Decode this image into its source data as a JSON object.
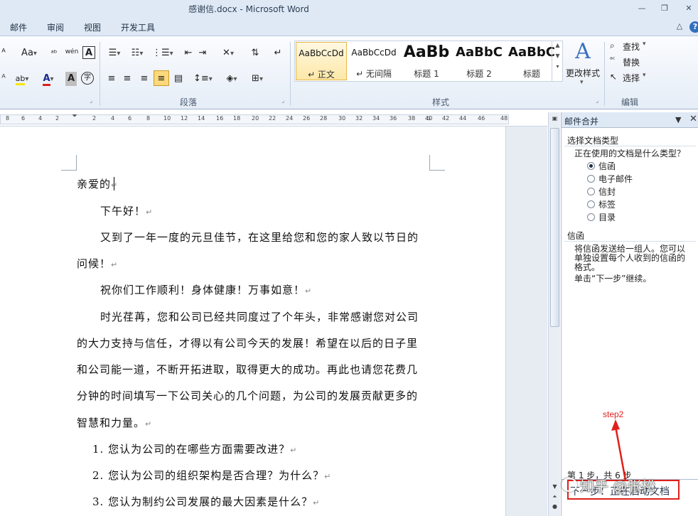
{
  "window": {
    "title": "感谢信.docx - Microsoft Word",
    "minimize": "—",
    "restore": "❐",
    "close": "✕"
  },
  "tabs": [
    "邮件",
    "审阅",
    "视图",
    "开发工具"
  ],
  "tab_controls": {
    "collapse": "△",
    "help": "?"
  },
  "ribbon": {
    "font": {
      "aa_label": "Aa",
      "pinyin_label": "wén",
      "border_char_label": "A",
      "font_color_label": "A",
      "highlight_label": "ab",
      "shading_label": "A",
      "enclose_label": "字"
    },
    "paragraph_label": "段落",
    "styles_label": "样式",
    "editing_label": "编辑",
    "styles": [
      {
        "preview": "AaBbCcDd",
        "name": "↵ 正文",
        "selected": true
      },
      {
        "preview": "AaBbCcDd",
        "name": "↵ 无间隔",
        "selected": false
      },
      {
        "preview": "AaBb",
        "name": "标题 1",
        "selected": false
      },
      {
        "preview": "AaBbC",
        "name": "标题 2",
        "selected": false
      },
      {
        "preview": "AaBbC",
        "name": "标题",
        "selected": false
      }
    ],
    "change_styles_label": "更改样式",
    "find_label": "查找",
    "replace_label": "替换",
    "select_label": "选择"
  },
  "ruler": {
    "numbers": [
      "8",
      "6",
      "4",
      "2",
      "2",
      "4",
      "6",
      "8",
      "10",
      "12",
      "14",
      "16",
      "18",
      "20",
      "22",
      "24",
      "26",
      "28",
      "30",
      "32",
      "34",
      "36",
      "38",
      "40",
      "42",
      "44",
      "46",
      "48"
    ]
  },
  "document": {
    "lines": [
      {
        "text": "亲爱的",
        "mark": "↵"
      },
      {
        "text": "下午好！",
        "mark": "↵"
      },
      {
        "text": "又到了一年一度的元旦佳节，在这里给您和您的家人致以节日的",
        "mark": ""
      },
      {
        "text": "问候！",
        "mark": "↵"
      },
      {
        "text": "祝你们工作顺利！身体健康！万事如意！",
        "mark": "↵"
      },
      {
        "text": "时光荏苒，您和公司已经共同度过了个年头，非常感谢您对公司",
        "mark": ""
      },
      {
        "text": "的大力支持与信任，才得以有公司今天的发展！希望在以后的日子里",
        "mark": ""
      },
      {
        "text": "和公司能一道，不断开拓进取，取得更大的成功。再此也请您花费几",
        "mark": ""
      },
      {
        "text": "分钟的时间填写一下公司关心的几个问题，为公司的发展贡献更多的",
        "mark": ""
      },
      {
        "text": "智慧和力量。",
        "mark": "↵"
      },
      {
        "text": "1.  您认为公司的在哪些方面需要改进？",
        "mark": "↵"
      },
      {
        "text": "2.  您认为公司的组织架构是否合理？为什么？",
        "mark": "↵"
      },
      {
        "text": "3.  您认为制约公司发展的最大因素是什么？",
        "mark": "↵"
      }
    ]
  },
  "task_pane": {
    "title": "邮件合并",
    "dropdown": "▼",
    "close": "✕",
    "section_heading": "选择文档类型",
    "question": "正在使用的文档是什么类型？",
    "options": [
      {
        "label": "信函",
        "selected": true
      },
      {
        "label": "电子邮件",
        "selected": false
      },
      {
        "label": "信封",
        "selected": false
      },
      {
        "label": "标签",
        "selected": false
      },
      {
        "label": "目录",
        "selected": false
      }
    ],
    "info_heading": "信函",
    "info_line1": "将信函发送给一组人。您可以",
    "info_line2": "单独设置每个人收到的信函的",
    "info_line3": "格式。",
    "info_continue": "单击“下一步”继续。",
    "step_text": "第 1 步，共 6 步",
    "next_button": "下一步：正在启动文档",
    "annotation": "step2",
    "watermark": "知乎 @张松"
  },
  "colors": {
    "ribbon_bg": "#e5edf7",
    "title_bg": "#dfe9f5",
    "annotation_red": "#e0201a",
    "selected_style_border": "#e8b84a"
  }
}
